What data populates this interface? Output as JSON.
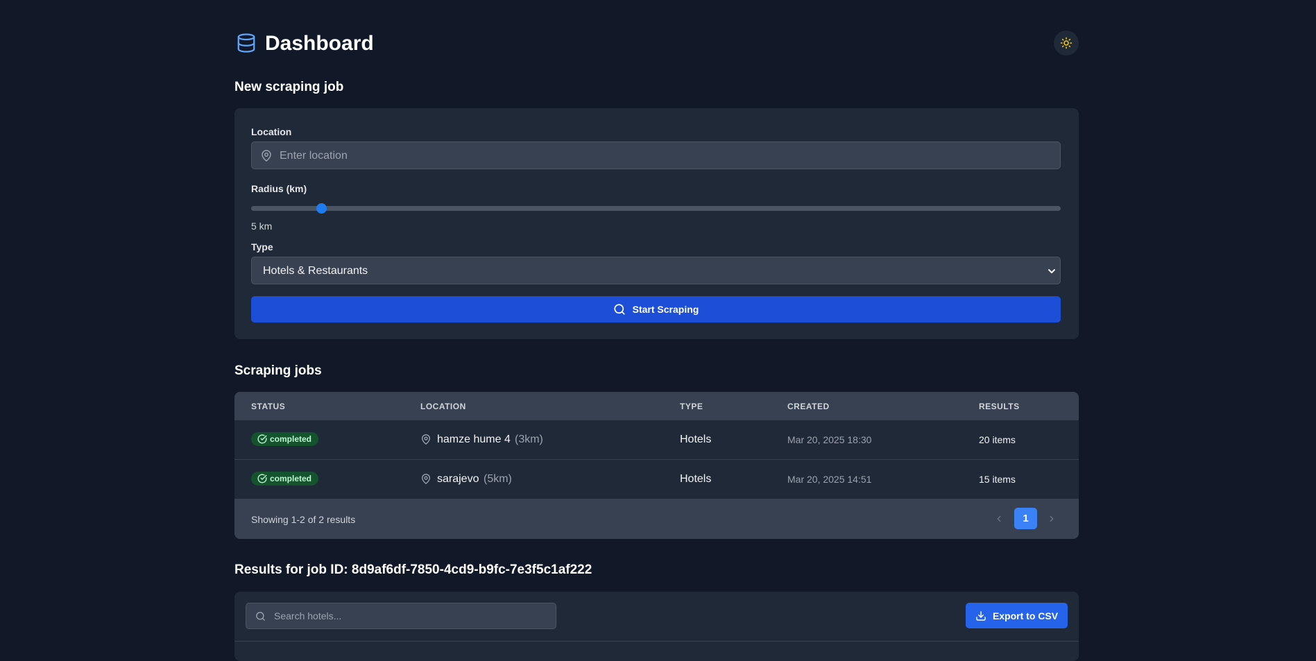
{
  "header": {
    "title": "Dashboard",
    "logo_icon": "database-icon",
    "theme_icon": "sun-icon"
  },
  "new_job": {
    "section_title": "New scraping job",
    "location_label": "Location",
    "location_placeholder": "Enter location",
    "radius_label": "Radius (km)",
    "radius_value": 5,
    "radius_range": [
      1,
      50
    ],
    "radius_text": "5 km",
    "type_label": "Type",
    "type_selected": "Hotels & Restaurants",
    "start_button": "Start Scraping"
  },
  "jobs": {
    "section_title": "Scraping jobs",
    "columns": [
      "STATUS",
      "LOCATION",
      "TYPE",
      "CREATED",
      "RESULTS"
    ],
    "rows": [
      {
        "status": "completed",
        "location": "hamze hume 4",
        "radius": "(3km)",
        "type": "Hotels",
        "created": "Mar 20, 2025 18:30",
        "results": "20 items"
      },
      {
        "status": "completed",
        "location": "sarajevo",
        "radius": "(5km)",
        "type": "Hotels",
        "created": "Mar 20, 2025 14:51",
        "results": "15 items"
      }
    ],
    "footer_text": "Showing 1-2 of 2 results",
    "current_page": "1"
  },
  "results": {
    "section_title": "Results for job ID: 8d9af6df-7850-4cd9-b9fc-7e3f5c1af222",
    "search_placeholder": "Search hotels...",
    "export_button": "Export to CSV"
  },
  "colors": {
    "background": "#111827",
    "card": "#1f2937",
    "primary": "#1d4ed8",
    "accent": "#3b82f6",
    "badge": "#14532d"
  }
}
